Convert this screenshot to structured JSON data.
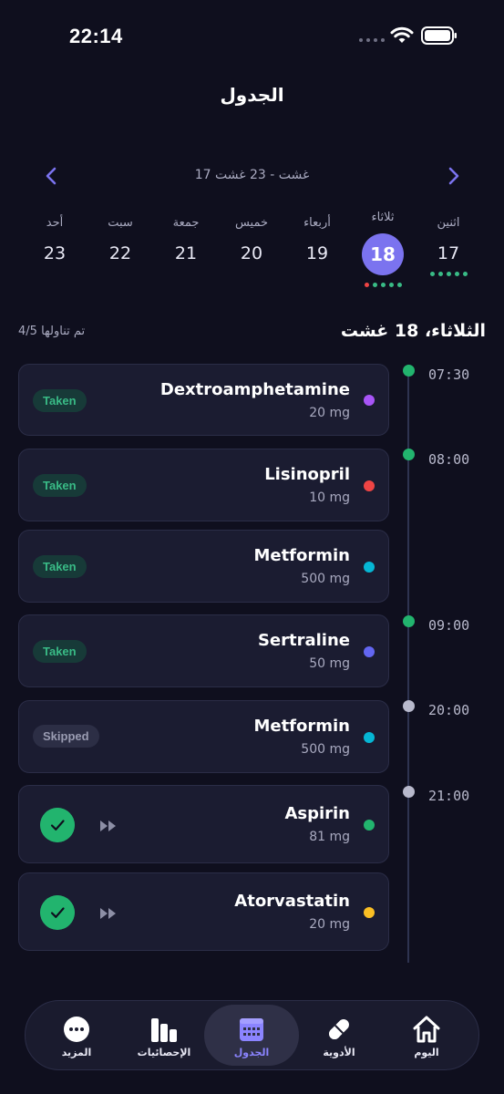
{
  "status_bar": {
    "time": "22:14"
  },
  "header": {
    "title": "الجدول"
  },
  "week_nav": {
    "range": "17 غشت - 23 غشت"
  },
  "days": [
    {
      "name": "اثنين",
      "num": "17"
    },
    {
      "name": "ثلاثاء",
      "num": "18"
    },
    {
      "name": "أربعاء",
      "num": "19"
    },
    {
      "name": "خميس",
      "num": "20"
    },
    {
      "name": "جمعة",
      "num": "21"
    },
    {
      "name": "سبت",
      "num": "22"
    },
    {
      "name": "أحد",
      "num": "23"
    }
  ],
  "selected_day": {
    "date_heading": "الثلاثاء، 18 غشت",
    "count": "4/5 تم تناولها"
  },
  "times": [
    "07:30",
    "08:00",
    "09:00",
    "20:00",
    "21:00"
  ],
  "doses": [
    {
      "name": "Dextroamphetamine",
      "dose": "20 mg",
      "status": "Taken",
      "color": "#a855f7"
    },
    {
      "name": "Lisinopril",
      "dose": "10 mg",
      "status": "Taken",
      "color": "#ef4444"
    },
    {
      "name": "Metformin",
      "dose": "500 mg",
      "status": "Taken",
      "color": "#06b6d4"
    },
    {
      "name": "Sertraline",
      "dose": "50 mg",
      "status": "Taken",
      "color": "#6366f1"
    },
    {
      "name": "Metformin",
      "dose": "500 mg",
      "status": "Skipped",
      "color": "#06b6d4"
    },
    {
      "name": "Aspirin",
      "dose": "81 mg",
      "status": "",
      "color": "#22b46e"
    },
    {
      "name": "Atorvastatin",
      "dose": "20 mg",
      "status": "",
      "color": "#fbbf24"
    }
  ],
  "colors": {
    "accent": "#7b73ef",
    "taken": "#39bb86",
    "missed": "#ef4444",
    "pending": "#b8b9cc"
  },
  "tabs": [
    {
      "label": "اليوم",
      "icon": "home-icon"
    },
    {
      "label": "الأدوية",
      "icon": "pill-icon"
    },
    {
      "label": "الجدول",
      "icon": "calendar-icon"
    },
    {
      "label": "الإحصائيات",
      "icon": "bar-chart-icon"
    },
    {
      "label": "المزيد",
      "icon": "more-icon"
    }
  ]
}
